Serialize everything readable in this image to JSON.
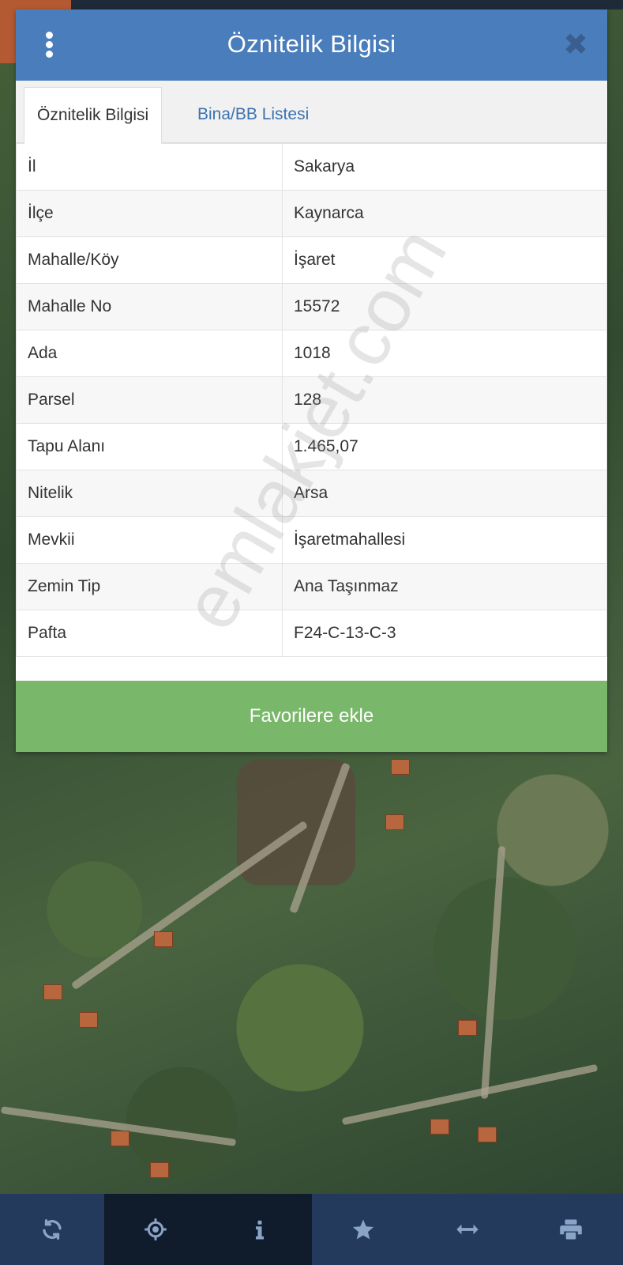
{
  "header": {
    "title": "Öznitelik Bilgisi"
  },
  "tabs": [
    {
      "label": "Öznitelik Bilgisi",
      "active": true
    },
    {
      "label": "Bina/BB Listesi",
      "active": false
    }
  ],
  "attributes": [
    {
      "key": "İl",
      "value": "Sakarya"
    },
    {
      "key": "İlçe",
      "value": "Kaynarca"
    },
    {
      "key": "Mahalle/Köy",
      "value": "İşaret"
    },
    {
      "key": "Mahalle No",
      "value": "15572"
    },
    {
      "key": "Ada",
      "value": "1018"
    },
    {
      "key": "Parsel",
      "value": "128"
    },
    {
      "key": "Tapu Alanı",
      "value": "1.465,07"
    },
    {
      "key": "Nitelik",
      "value": "Arsa"
    },
    {
      "key": "Mevkii",
      "value": "İşaretmahallesi"
    },
    {
      "key": "Zemin Tip",
      "value": "Ana Taşınmaz"
    },
    {
      "key": "Pafta",
      "value": "F24-C-13-C-3"
    }
  ],
  "favorite_button": "Favorilere ekle",
  "watermark": "emlakjet.com",
  "toolbar": [
    {
      "icon": "refresh-icon"
    },
    {
      "icon": "crosshair-icon"
    },
    {
      "icon": "info-icon"
    },
    {
      "icon": "star-icon"
    },
    {
      "icon": "measure-icon"
    },
    {
      "icon": "print-icon"
    }
  ],
  "colors": {
    "header": "#4a7dbb",
    "favorite_button": "#79b86a",
    "toolbar": "#243a5c",
    "toolbar_active": "#101b2b",
    "tab_link": "#3a72b0"
  }
}
